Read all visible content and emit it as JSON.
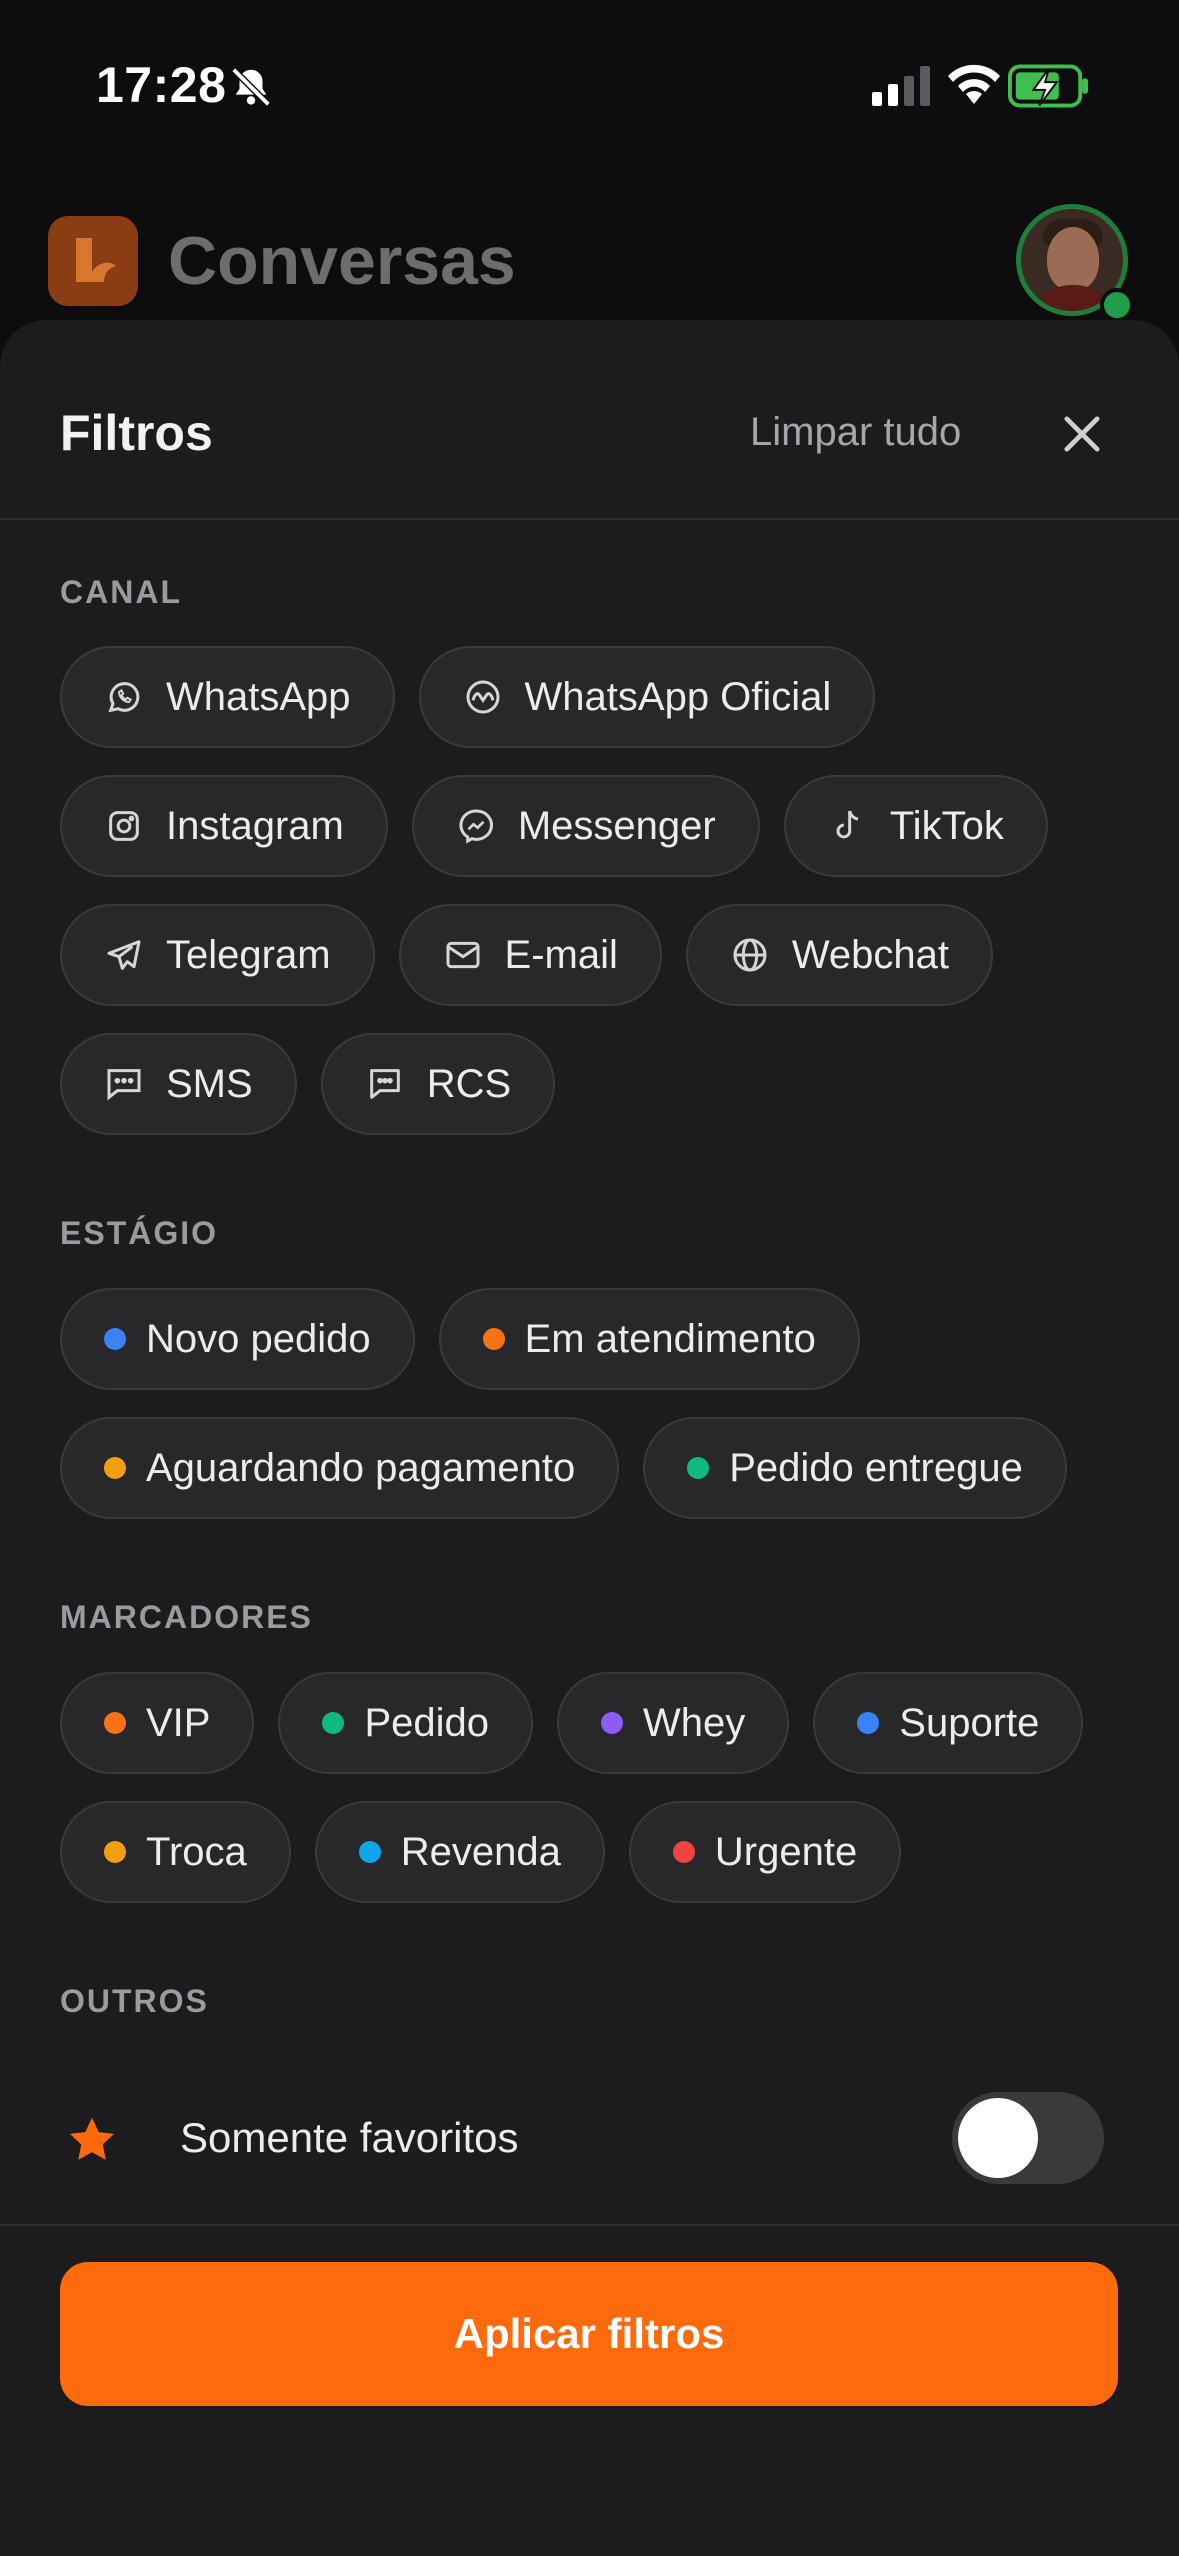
{
  "status_bar": {
    "time": "17:28"
  },
  "app": {
    "title": "Conversas"
  },
  "sheet": {
    "title": "Filtros",
    "clear_all": "Limpar tudo",
    "apply_label": "Aplicar filtros"
  },
  "sections": {
    "canal": "CANAL",
    "estagio": "ESTÁGIO",
    "marcadores": "MARCADORES",
    "outros": "OUTROS"
  },
  "channels": [
    {
      "label": "WhatsApp",
      "icon": "whatsapp-icon"
    },
    {
      "label": "WhatsApp Oficial",
      "icon": "meta-icon"
    },
    {
      "label": "Instagram",
      "icon": "instagram-icon"
    },
    {
      "label": "Messenger",
      "icon": "messenger-icon"
    },
    {
      "label": "TikTok",
      "icon": "tiktok-icon"
    },
    {
      "label": "Telegram",
      "icon": "telegram-icon"
    },
    {
      "label": "E-mail",
      "icon": "mail-icon"
    },
    {
      "label": "Webchat",
      "icon": "globe-icon"
    },
    {
      "label": "SMS",
      "icon": "sms-icon"
    },
    {
      "label": "RCS",
      "icon": "rcs-icon"
    }
  ],
  "stages": [
    {
      "label": "Novo pedido",
      "color": "#3b82f6"
    },
    {
      "label": "Em atendimento",
      "color": "#f97316"
    },
    {
      "label": "Aguardando pagamento",
      "color": "#f59e0b"
    },
    {
      "label": "Pedido entregue",
      "color": "#10b981"
    }
  ],
  "tags": [
    {
      "label": "VIP",
      "color": "#f97316"
    },
    {
      "label": "Pedido",
      "color": "#10b981"
    },
    {
      "label": "Whey",
      "color": "#8b5cf6"
    },
    {
      "label": "Suporte",
      "color": "#3b82f6"
    },
    {
      "label": "Troca",
      "color": "#f59e0b"
    },
    {
      "label": "Revenda",
      "color": "#0ea5e9"
    },
    {
      "label": "Urgente",
      "color": "#ef4444"
    }
  ],
  "others": {
    "favorites_label": "Somente favoritos",
    "favorites_on": false
  },
  "colors": {
    "accent": "#ff6a0c",
    "sheet_bg": "#1c1c1e",
    "chip_bg": "#28282b"
  }
}
